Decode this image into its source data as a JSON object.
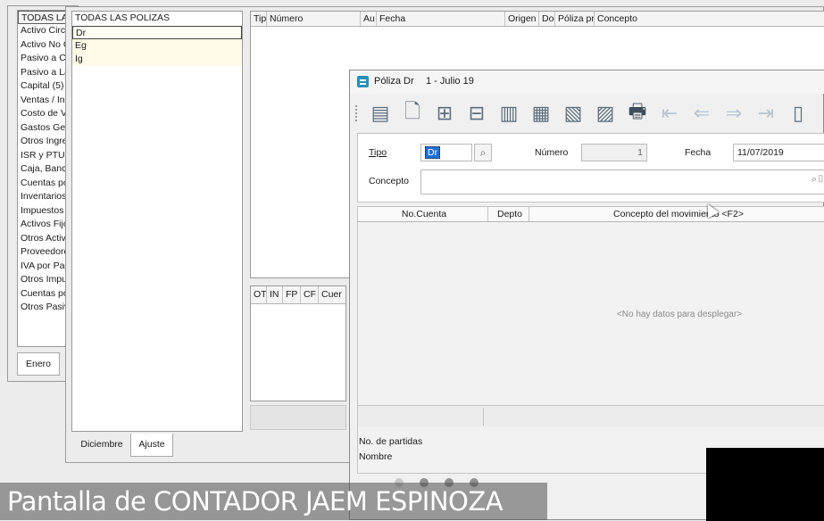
{
  "accounts_list": {
    "header": "TODAS LAS",
    "items": [
      "Activo Circu",
      "Activo No C",
      "Pasivo a Co",
      "Pasivo a La",
      "Capital (5)",
      "Ventas / Ing",
      "Costo de Ve",
      "Gastos Gen",
      "Otros Ingres",
      "ISR y PTU",
      "Caja, Banco",
      "Cuentas po",
      "Inventarios",
      "Impuestos A",
      "Activos Fijo",
      "Otros Activo",
      "Proveedore",
      "IVA por Pag",
      "Otros Impue",
      "Cuentas po",
      "Otros Pasiv"
    ],
    "tab_label": "Enero"
  },
  "polizas_list": {
    "header": "TODAS LAS POLIZAS",
    "items": [
      "Dr",
      "Eg",
      "Ig"
    ],
    "tabs": [
      "Diciembre",
      "Ajuste"
    ]
  },
  "grid": {
    "columns": [
      "Tip",
      "Número",
      "Au",
      "Fecha",
      "Origen",
      "Doc",
      "Póliza pr",
      "Concepto"
    ],
    "lower_columns": [
      "OT",
      "IN",
      "FP",
      "CF",
      "Cuer"
    ]
  },
  "dialog": {
    "title": "Póliza Dr",
    "subtitle": "1 - Julio 19",
    "tipo_label": "Tipo",
    "tipo_value": "Dr",
    "numero_label": "Número",
    "numero_value": "1",
    "fecha_label": "Fecha",
    "fecha_value": "11/07/2019",
    "concepto_label": "Concepto",
    "columns": [
      "No.Cuenta",
      "Depto",
      "Concepto del movimiento <F2>"
    ],
    "empty_message": "<No hay datos para desplegar>",
    "footer_partidas": "No. de partidas",
    "footer_nombre": "Nombre"
  },
  "caption": "Pantalla de CONTADOR JAEM ESPINOZA",
  "colors": {
    "accent": "#2a7fa8",
    "selection": "#1e6fd9",
    "toolbar_icon": "#5c6e7c"
  }
}
